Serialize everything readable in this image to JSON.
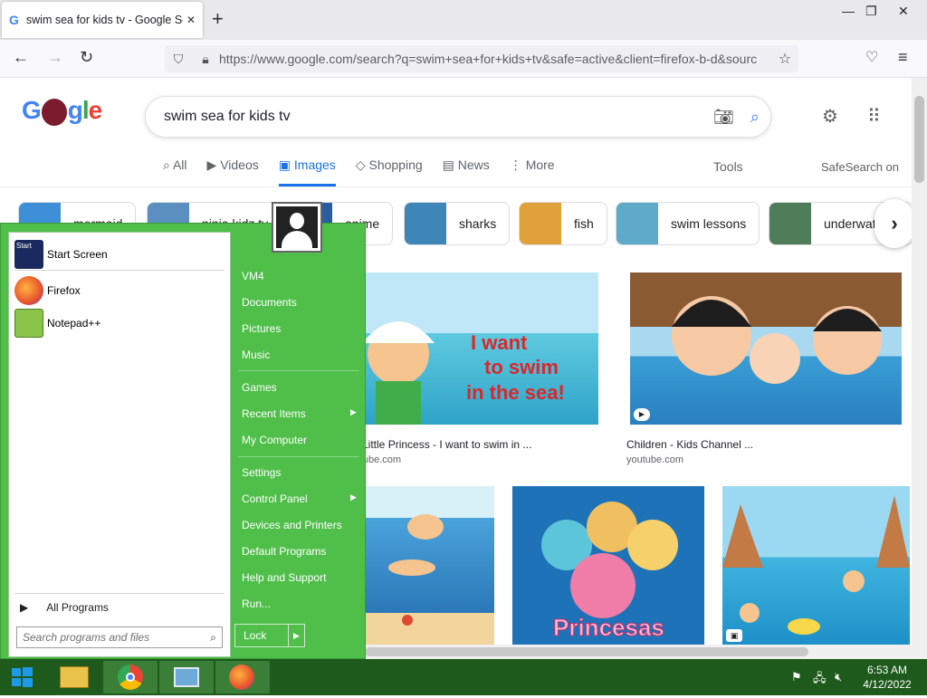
{
  "browser": {
    "tab_title": "swim sea for kids tv - Google Se",
    "url": "https://www.google.com/search?q=swim+sea+for+kids+tv&safe=active&client=firefox-b-d&sourc"
  },
  "google": {
    "logo_letters": [
      "G",
      "g",
      "l",
      "e"
    ],
    "query": "swim sea for kids tv",
    "tabs": [
      "All",
      "Videos",
      "Images",
      "Shopping",
      "News",
      "More"
    ],
    "tab_icons": [
      "⌕",
      "▶",
      "▣",
      "◇",
      "▤",
      "⋮"
    ],
    "tools": "Tools",
    "safesearch": "SafeSearch on",
    "chips": [
      "mermaid",
      "ninja kidz tv",
      "anime",
      "sharks",
      "fish",
      "swim lessons",
      "underwat"
    ],
    "results": [
      {
        "caption": "The Little Princess - I want to swim in ...",
        "source": "YouTube.com"
      },
      {
        "caption": "Children - Kids Channel ...",
        "source": "youtube.com"
      }
    ],
    "colors": {
      "blue": "#4285f4",
      "red": "#ea4335",
      "yellow": "#fbbc05",
      "green": "#34a853",
      "active_tab": "#1a73e8"
    }
  },
  "startmenu": {
    "pinned": [
      "Start Screen",
      "Firefox",
      "Notepad++"
    ],
    "all_programs": "All Programs",
    "search_placeholder": "Search programs and files",
    "right_links": [
      "VM4",
      "Documents",
      "Pictures",
      "Music",
      "Games",
      "Recent Items",
      "My Computer",
      "Settings",
      "Control Panel",
      "Devices and Printers",
      "Default Programs",
      "Help and Support",
      "Run..."
    ],
    "lock": "Lock",
    "accent": "#4fbf4a"
  },
  "taskbar": {
    "time": "6:53 AM",
    "date": "4/12/2022",
    "color": "#1d5a1c"
  }
}
